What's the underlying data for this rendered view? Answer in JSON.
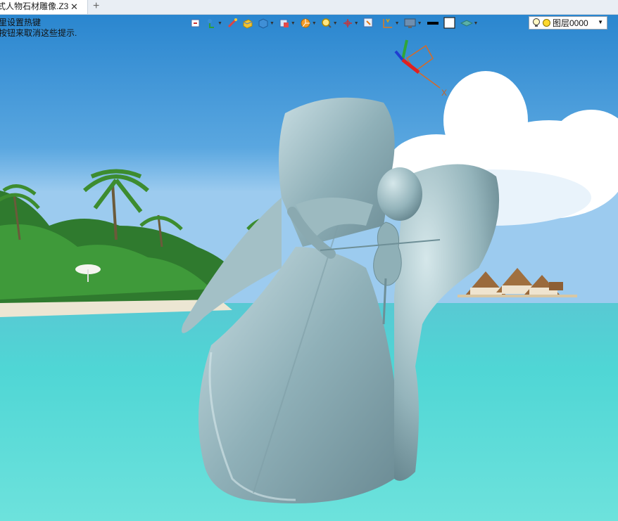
{
  "tabs": [
    {
      "label": "式人物石材雕像.Z3",
      "close_glyph": "✕"
    }
  ],
  "new_tab_glyph": "+",
  "hint": {
    "line1": "里设置热键",
    "line2": "按钮来取消这些提示."
  },
  "axis": {
    "x_label": "X"
  },
  "layer": {
    "label": "图层0000"
  },
  "toolbar_icons": [
    "view-restore-icon",
    "snap-icon",
    "pick-icon",
    "shade-box-icon",
    "solid-box-icon",
    "view-cube-icon",
    "pie-icon",
    "zoom-icon",
    "triad-icon",
    "grid-icon",
    "workplane-icon",
    "monitor-icon",
    "line-color-icon",
    "fill-color-icon",
    "layer-stack-icon"
  ]
}
